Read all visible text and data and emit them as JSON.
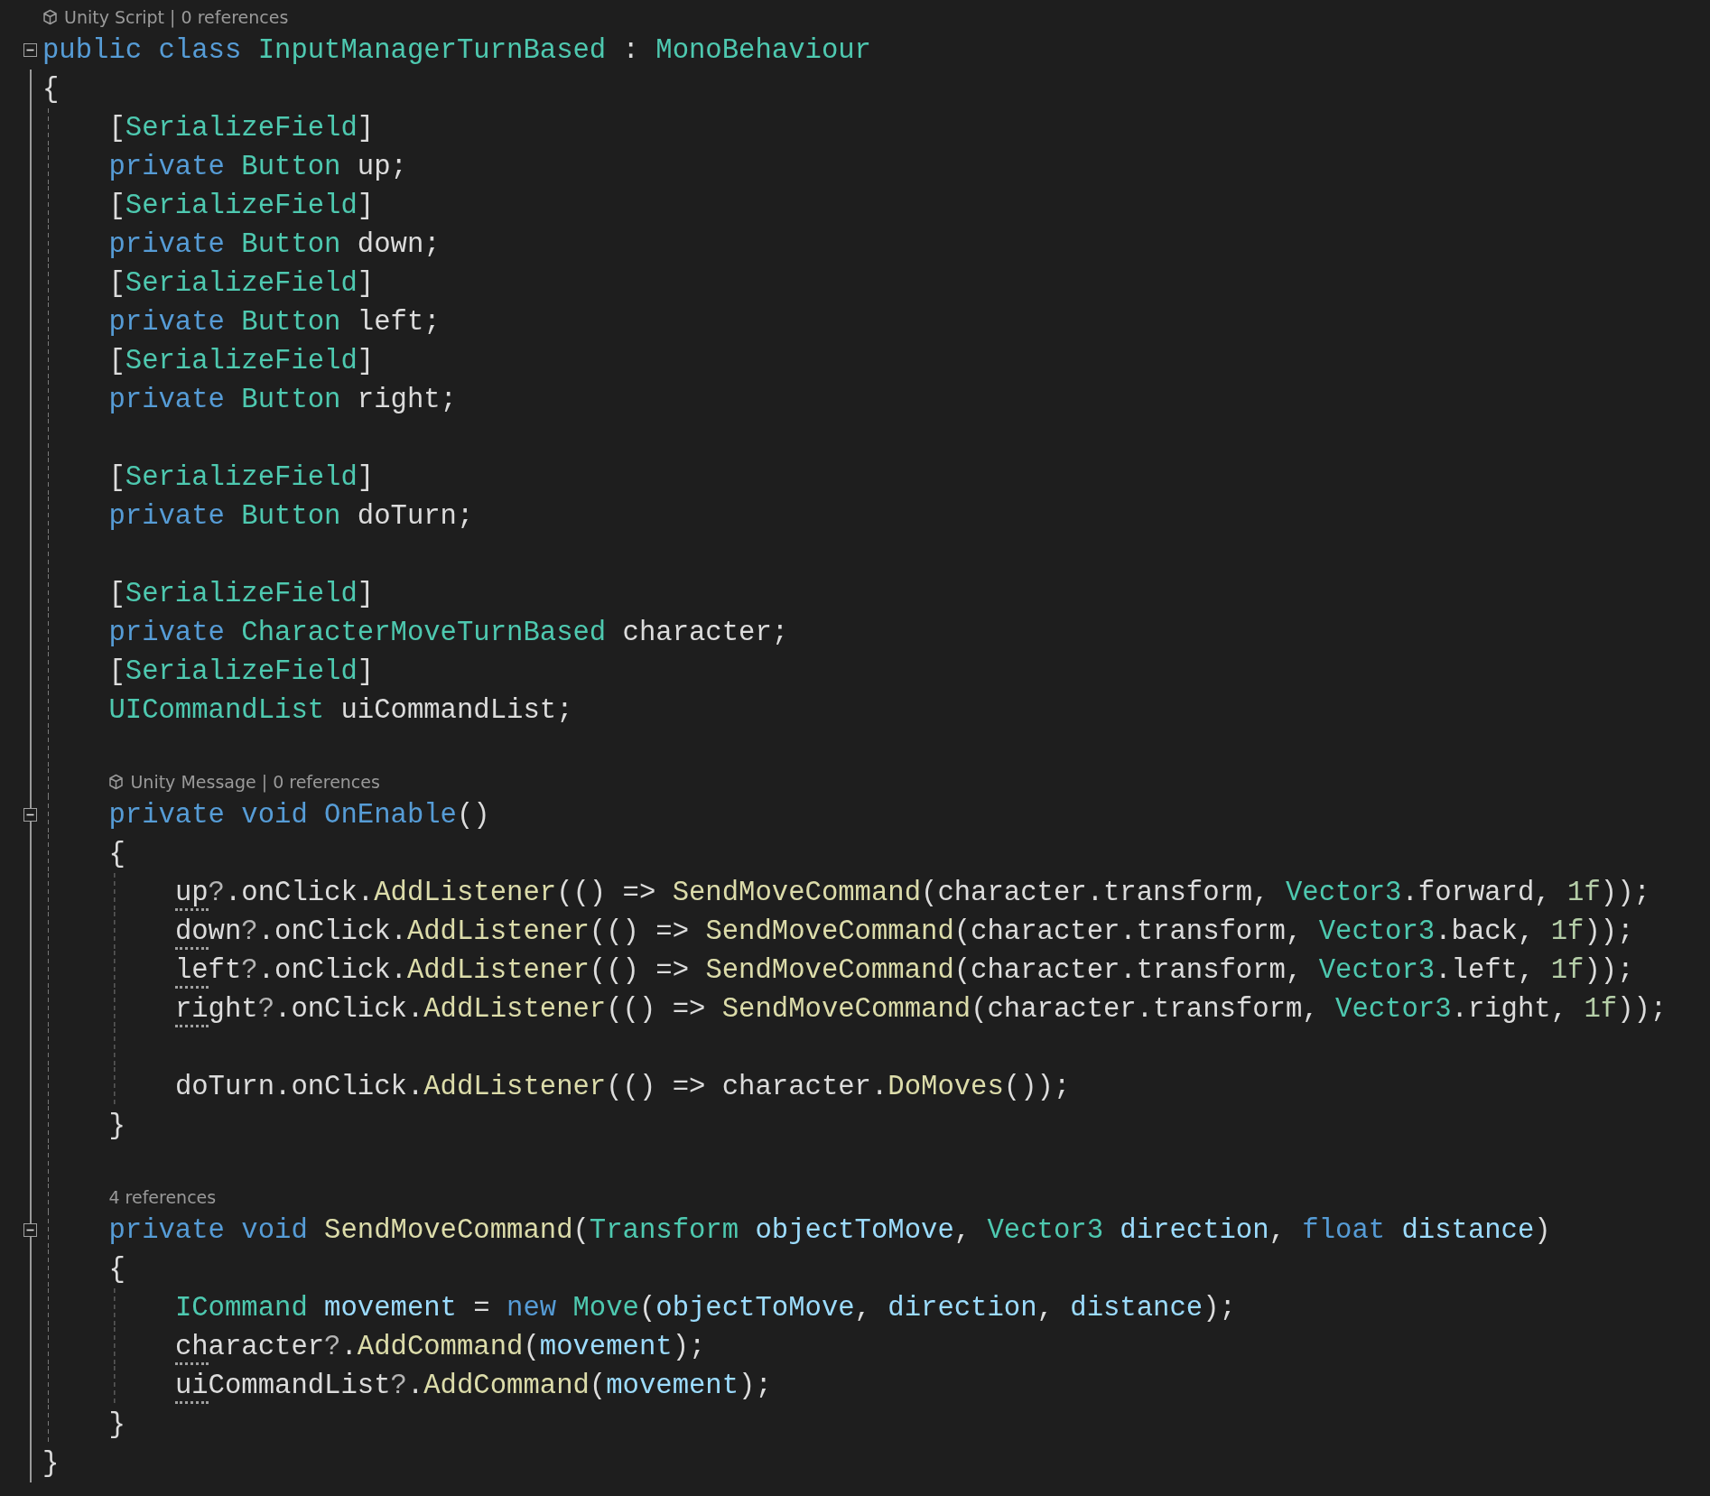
{
  "editor": {
    "rows": [
      {
        "kind": "lens",
        "fold": false,
        "icon": true,
        "text": "Unity Script | 0 references"
      },
      {
        "kind": "code",
        "fold": true,
        "tokens": [
          {
            "kind": "keyword",
            "text": "public class "
          },
          {
            "kind": "type",
            "text": "InputManagerTurnBased"
          },
          {
            "kind": "plain",
            "text": " : "
          },
          {
            "kind": "type",
            "text": "MonoBehaviour"
          }
        ]
      },
      {
        "kind": "code",
        "fold": false,
        "tokens": [
          {
            "kind": "plain",
            "text": "{"
          }
        ]
      },
      {
        "kind": "code",
        "fold": false,
        "indent": "    ",
        "tokens": [
          {
            "kind": "plain",
            "text": "["
          },
          {
            "kind": "type",
            "text": "SerializeField"
          },
          {
            "kind": "plain",
            "text": "]"
          }
        ]
      },
      {
        "kind": "code",
        "fold": false,
        "indent": "    ",
        "tokens": [
          {
            "kind": "keyword",
            "text": "private "
          },
          {
            "kind": "type",
            "text": "Button"
          },
          {
            "kind": "plain",
            "text": " up;"
          }
        ]
      },
      {
        "kind": "code",
        "fold": false,
        "indent": "    ",
        "tokens": [
          {
            "kind": "plain",
            "text": "["
          },
          {
            "kind": "type",
            "text": "SerializeField"
          },
          {
            "kind": "plain",
            "text": "]"
          }
        ]
      },
      {
        "kind": "code",
        "fold": false,
        "indent": "    ",
        "tokens": [
          {
            "kind": "keyword",
            "text": "private "
          },
          {
            "kind": "type",
            "text": "Button"
          },
          {
            "kind": "plain",
            "text": " down;"
          }
        ]
      },
      {
        "kind": "code",
        "fold": false,
        "indent": "    ",
        "tokens": [
          {
            "kind": "plain",
            "text": "["
          },
          {
            "kind": "type",
            "text": "SerializeField"
          },
          {
            "kind": "plain",
            "text": "]"
          }
        ]
      },
      {
        "kind": "code",
        "fold": false,
        "indent": "    ",
        "tokens": [
          {
            "kind": "keyword",
            "text": "private "
          },
          {
            "kind": "type",
            "text": "Button"
          },
          {
            "kind": "plain",
            "text": " left;"
          }
        ]
      },
      {
        "kind": "code",
        "fold": false,
        "indent": "    ",
        "tokens": [
          {
            "kind": "plain",
            "text": "["
          },
          {
            "kind": "type",
            "text": "SerializeField"
          },
          {
            "kind": "plain",
            "text": "]"
          }
        ]
      },
      {
        "kind": "code",
        "fold": false,
        "indent": "    ",
        "tokens": [
          {
            "kind": "keyword",
            "text": "private "
          },
          {
            "kind": "type",
            "text": "Button"
          },
          {
            "kind": "plain",
            "text": " right;"
          }
        ]
      },
      {
        "kind": "blank",
        "fold": false,
        "indent": "    "
      },
      {
        "kind": "code",
        "fold": false,
        "indent": "    ",
        "tokens": [
          {
            "kind": "plain",
            "text": "["
          },
          {
            "kind": "type",
            "text": "SerializeField"
          },
          {
            "kind": "plain",
            "text": "]"
          }
        ]
      },
      {
        "kind": "code",
        "fold": false,
        "indent": "    ",
        "tokens": [
          {
            "kind": "keyword",
            "text": "private "
          },
          {
            "kind": "type",
            "text": "Button"
          },
          {
            "kind": "plain",
            "text": " doTurn;"
          }
        ]
      },
      {
        "kind": "blank",
        "fold": false,
        "indent": "    "
      },
      {
        "kind": "code",
        "fold": false,
        "indent": "    ",
        "tokens": [
          {
            "kind": "plain",
            "text": "["
          },
          {
            "kind": "type",
            "text": "SerializeField"
          },
          {
            "kind": "plain",
            "text": "]"
          }
        ]
      },
      {
        "kind": "code",
        "fold": false,
        "indent": "    ",
        "tokens": [
          {
            "kind": "keyword",
            "text": "private "
          },
          {
            "kind": "type",
            "text": "CharacterMoveTurnBased"
          },
          {
            "kind": "plain",
            "text": " character;"
          }
        ]
      },
      {
        "kind": "code",
        "fold": false,
        "indent": "    ",
        "tokens": [
          {
            "kind": "plain",
            "text": "["
          },
          {
            "kind": "type",
            "text": "SerializeField"
          },
          {
            "kind": "plain",
            "text": "]"
          }
        ]
      },
      {
        "kind": "code",
        "fold": false,
        "indent": "    ",
        "tokens": [
          {
            "kind": "type",
            "text": "UICommandList"
          },
          {
            "kind": "plain",
            "text": " uiCommandList;"
          }
        ]
      },
      {
        "kind": "blank",
        "fold": false,
        "indent": "    "
      },
      {
        "kind": "lens",
        "fold": false,
        "indent": "    ",
        "icon": true,
        "text": "Unity Message | 0 references"
      },
      {
        "kind": "code",
        "fold": true,
        "indent": "    ",
        "tokens": [
          {
            "kind": "keyword",
            "text": "private void OnEnable"
          },
          {
            "kind": "plain",
            "text": "()"
          }
        ]
      },
      {
        "kind": "code",
        "fold": false,
        "indent": "    ",
        "tokens": [
          {
            "kind": "plain",
            "text": "{"
          }
        ]
      },
      {
        "kind": "code",
        "fold": false,
        "indent": "        ",
        "tokens": [
          {
            "kind": "hint",
            "text": "up"
          },
          {
            "kind": "operator",
            "text": "?"
          },
          {
            "kind": "plain",
            "text": ".onClick."
          },
          {
            "kind": "method",
            "text": "AddListener"
          },
          {
            "kind": "plain",
            "text": "(() => "
          },
          {
            "kind": "method",
            "text": "SendMoveCommand"
          },
          {
            "kind": "plain",
            "text": "(character.transform, "
          },
          {
            "kind": "type",
            "text": "Vector3"
          },
          {
            "kind": "plain",
            "text": ".forward, "
          },
          {
            "kind": "number",
            "text": "1f"
          },
          {
            "kind": "plain",
            "text": "));"
          }
        ]
      },
      {
        "kind": "code",
        "fold": false,
        "indent": "        ",
        "tokens": [
          {
            "kind": "hint",
            "text": "down"
          },
          {
            "kind": "operator",
            "text": "?"
          },
          {
            "kind": "plain",
            "text": ".onClick."
          },
          {
            "kind": "method",
            "text": "AddListener"
          },
          {
            "kind": "plain",
            "text": "(() => "
          },
          {
            "kind": "method",
            "text": "SendMoveCommand"
          },
          {
            "kind": "plain",
            "text": "(character.transform, "
          },
          {
            "kind": "type",
            "text": "Vector3"
          },
          {
            "kind": "plain",
            "text": ".back, "
          },
          {
            "kind": "number",
            "text": "1f"
          },
          {
            "kind": "plain",
            "text": "));"
          }
        ]
      },
      {
        "kind": "code",
        "fold": false,
        "indent": "        ",
        "tokens": [
          {
            "kind": "hint",
            "text": "left"
          },
          {
            "kind": "operator",
            "text": "?"
          },
          {
            "kind": "plain",
            "text": ".onClick."
          },
          {
            "kind": "method",
            "text": "AddListener"
          },
          {
            "kind": "plain",
            "text": "(() => "
          },
          {
            "kind": "method",
            "text": "SendMoveCommand"
          },
          {
            "kind": "plain",
            "text": "(character.transform, "
          },
          {
            "kind": "type",
            "text": "Vector3"
          },
          {
            "kind": "plain",
            "text": ".left, "
          },
          {
            "kind": "number",
            "text": "1f"
          },
          {
            "kind": "plain",
            "text": "));"
          }
        ]
      },
      {
        "kind": "code",
        "fold": false,
        "indent": "        ",
        "tokens": [
          {
            "kind": "hint",
            "text": "right"
          },
          {
            "kind": "operator",
            "text": "?"
          },
          {
            "kind": "plain",
            "text": ".onClick."
          },
          {
            "kind": "method",
            "text": "AddListener"
          },
          {
            "kind": "plain",
            "text": "(() => "
          },
          {
            "kind": "method",
            "text": "SendMoveCommand"
          },
          {
            "kind": "plain",
            "text": "(character.transform, "
          },
          {
            "kind": "type",
            "text": "Vector3"
          },
          {
            "kind": "plain",
            "text": ".right, "
          },
          {
            "kind": "number",
            "text": "1f"
          },
          {
            "kind": "plain",
            "text": "));"
          }
        ]
      },
      {
        "kind": "blank",
        "fold": false,
        "indent": "        "
      },
      {
        "kind": "code",
        "fold": false,
        "indent": "        ",
        "tokens": [
          {
            "kind": "plain",
            "text": "doTurn.onClick."
          },
          {
            "kind": "method",
            "text": "AddListener"
          },
          {
            "kind": "plain",
            "text": "(() => character."
          },
          {
            "kind": "method",
            "text": "DoMoves"
          },
          {
            "kind": "plain",
            "text": "());"
          }
        ]
      },
      {
        "kind": "code",
        "fold": false,
        "indent": "    ",
        "tokens": [
          {
            "kind": "plain",
            "text": "}"
          }
        ]
      },
      {
        "kind": "blank",
        "fold": false,
        "indent": "    "
      },
      {
        "kind": "lens",
        "fold": false,
        "indent": "    ",
        "icon": false,
        "text": "4 references"
      },
      {
        "kind": "code",
        "fold": true,
        "indent": "    ",
        "tokens": [
          {
            "kind": "keyword",
            "text": "private void "
          },
          {
            "kind": "method",
            "text": "SendMoveCommand"
          },
          {
            "kind": "plain",
            "text": "("
          },
          {
            "kind": "type",
            "text": "Transform"
          },
          {
            "kind": "variable",
            "text": " objectToMove"
          },
          {
            "kind": "plain",
            "text": ", "
          },
          {
            "kind": "type",
            "text": "Vector3"
          },
          {
            "kind": "variable",
            "text": " direction"
          },
          {
            "kind": "plain",
            "text": ", "
          },
          {
            "kind": "keyword",
            "text": "float"
          },
          {
            "kind": "variable",
            "text": " distance"
          },
          {
            "kind": "plain",
            "text": ")"
          }
        ]
      },
      {
        "kind": "code",
        "fold": false,
        "indent": "    ",
        "tokens": [
          {
            "kind": "plain",
            "text": "{"
          }
        ]
      },
      {
        "kind": "code",
        "fold": false,
        "indent": "        ",
        "tokens": [
          {
            "kind": "type",
            "text": "ICommand"
          },
          {
            "kind": "variable",
            "text": " movement"
          },
          {
            "kind": "plain",
            "text": " = "
          },
          {
            "kind": "keyword",
            "text": "new "
          },
          {
            "kind": "type",
            "text": "Move"
          },
          {
            "kind": "plain",
            "text": "("
          },
          {
            "kind": "variable",
            "text": "objectToMove"
          },
          {
            "kind": "plain",
            "text": ", "
          },
          {
            "kind": "variable",
            "text": "direction"
          },
          {
            "kind": "plain",
            "text": ", "
          },
          {
            "kind": "variable",
            "text": "distance"
          },
          {
            "kind": "plain",
            "text": ");"
          }
        ]
      },
      {
        "kind": "code",
        "fold": false,
        "indent": "        ",
        "tokens": [
          {
            "kind": "hint",
            "text": "character"
          },
          {
            "kind": "operator",
            "text": "?"
          },
          {
            "kind": "plain",
            "text": "."
          },
          {
            "kind": "method",
            "text": "AddCommand"
          },
          {
            "kind": "plain",
            "text": "("
          },
          {
            "kind": "variable",
            "text": "movement"
          },
          {
            "kind": "plain",
            "text": ");"
          }
        ]
      },
      {
        "kind": "code",
        "fold": false,
        "indent": "        ",
        "tokens": [
          {
            "kind": "hint",
            "text": "uiCommandList"
          },
          {
            "kind": "operator",
            "text": "?"
          },
          {
            "kind": "plain",
            "text": "."
          },
          {
            "kind": "method",
            "text": "AddCommand"
          },
          {
            "kind": "plain",
            "text": "("
          },
          {
            "kind": "variable",
            "text": "movement"
          },
          {
            "kind": "plain",
            "text": ");"
          }
        ]
      },
      {
        "kind": "code",
        "fold": false,
        "indent": "    ",
        "tokens": [
          {
            "kind": "plain",
            "text": "}"
          }
        ]
      },
      {
        "kind": "code",
        "fold": false,
        "tokens": [
          {
            "kind": "plain",
            "text": "}"
          }
        ]
      }
    ]
  }
}
